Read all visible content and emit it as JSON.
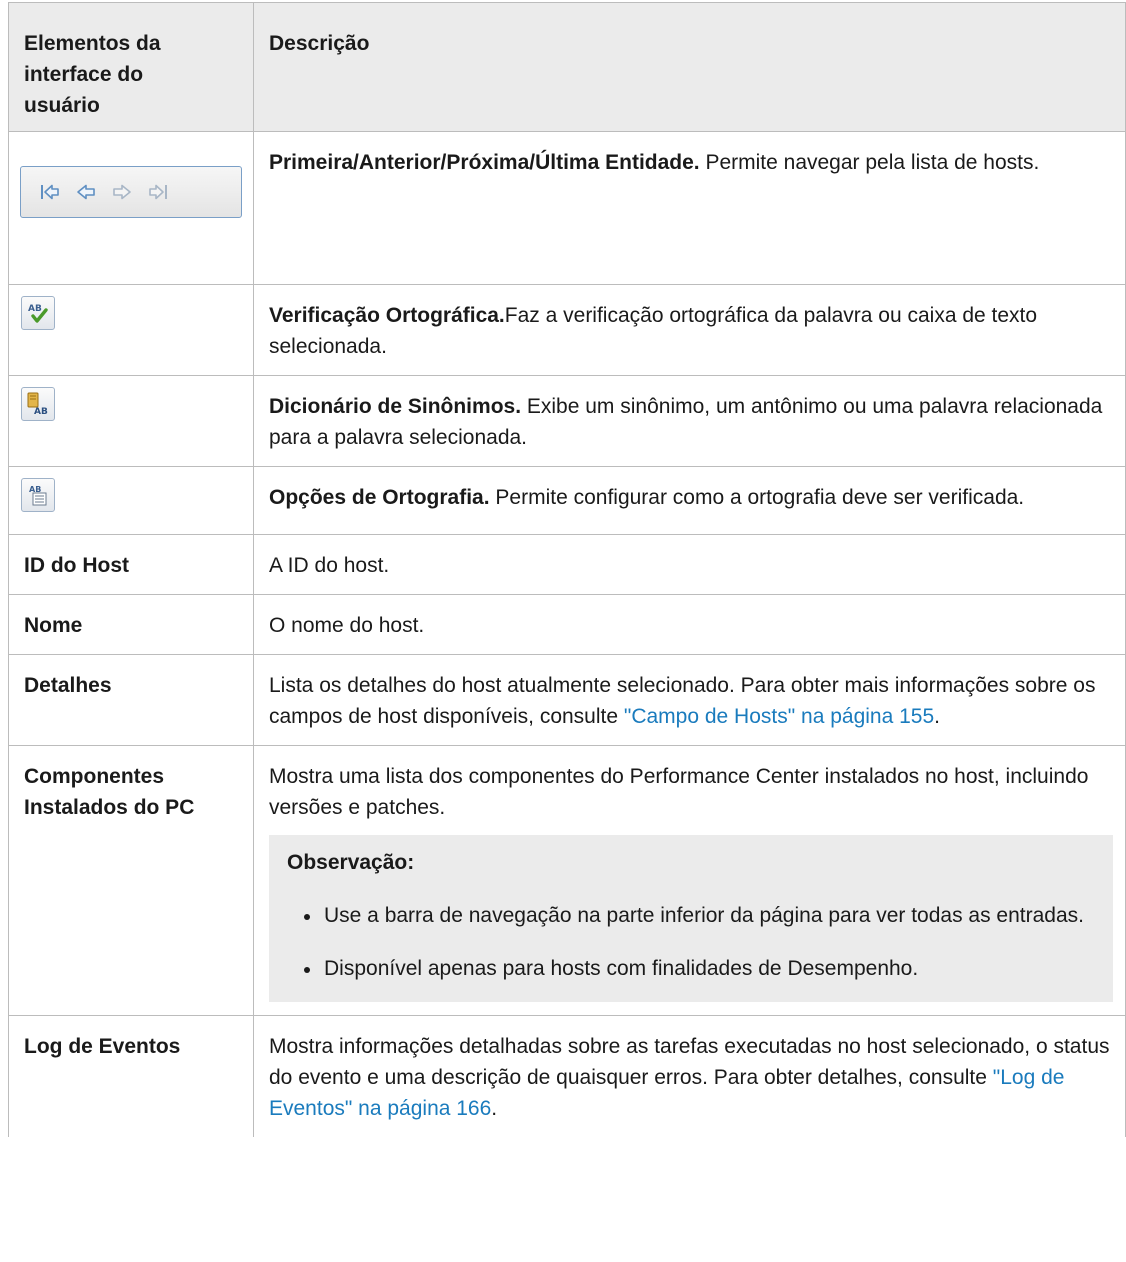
{
  "header": {
    "col1": "Elementos da interface do usuário",
    "col2": "Descrição"
  },
  "rows": {
    "nav": {
      "element_icons": [
        "first-entity-icon",
        "previous-entity-icon",
        "next-entity-icon",
        "last-entity-icon"
      ],
      "bold": "Primeira/Anterior/Próxima/Última Entidade.",
      "text": " Permite navegar pela lista de hosts."
    },
    "spell": {
      "element_icon": "spell-check-icon",
      "bold": "Verificação Ortográfica.",
      "text": "Faz a verificação ortográfica da palavra ou caixa de texto selecionada."
    },
    "thesaurus": {
      "element_icon": "thesaurus-icon",
      "bold": "Dicionário de Sinônimos.",
      "text": " Exibe um sinônimo, um antônimo ou uma palavra relacionada para a palavra selecionada."
    },
    "spelloptions": {
      "element_icon": "spelling-options-icon",
      "bold": "Opções de Ortografia.",
      "text": " Permite configurar como a ortografia deve ser verificada."
    },
    "hostid": {
      "label": "ID do Host",
      "text": "A ID do host."
    },
    "name": {
      "label": "Nome",
      "text": "O nome do host."
    },
    "details": {
      "label": "Detalhes",
      "text": "Lista os detalhes do host atualmente selecionado. Para obter mais informações sobre os campos de host disponíveis, consulte ",
      "link": "\"Campo de Hosts\" na página 155",
      "after": "."
    },
    "components": {
      "label": "Componentes Instalados do PC",
      "text": "Mostra uma lista dos componentes do Performance Center instalados no host, incluindo versões e patches.",
      "note_title": "Observação:",
      "note_items": [
        "Use a barra de navegação na parte inferior da página para ver todas as entradas.",
        "Disponível apenas para hosts com finalidades de Desempenho."
      ]
    },
    "eventlog": {
      "label": "Log de Eventos",
      "text": "Mostra informações detalhadas sobre as tarefas executadas no host selecionado, o status do evento e uma descrição de quaisquer erros. Para obter detalhes, consulte ",
      "link": "\"Log de Eventos\" na página 166",
      "after": "."
    }
  }
}
